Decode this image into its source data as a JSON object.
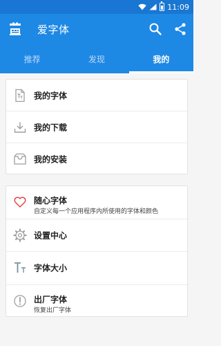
{
  "status_bar": {
    "time": "11:09"
  },
  "appbar": {
    "title": "爱字体",
    "icons": {
      "app": "app-logo-icon",
      "search": "search-icon",
      "share": "share-icon"
    }
  },
  "tabs": [
    {
      "label": "推荐",
      "active": false
    },
    {
      "label": "发现",
      "active": false
    },
    {
      "label": "我的",
      "active": true
    }
  ],
  "section1": {
    "items": [
      {
        "label": "我的字体",
        "icon": "font-file-icon"
      },
      {
        "label": "我的下载",
        "icon": "download-icon"
      },
      {
        "label": "我的安装",
        "icon": "inbox-icon"
      }
    ]
  },
  "section2": {
    "items": [
      {
        "label": "随心字体",
        "sub": "自定义每一个应用程序内所使用的字体和颜色",
        "icon": "heart-icon"
      },
      {
        "label": "设置中心",
        "icon": "gear-icon"
      },
      {
        "label": "字体大小",
        "icon": "font-size-icon"
      },
      {
        "label": "出厂字体",
        "sub": "恢复出厂字体",
        "icon": "restore-icon"
      }
    ]
  },
  "colors": {
    "primary": "#1e88e5",
    "status_bar": "#1976d2",
    "heart": "#e53935",
    "icon_gray": "#9e9e9e"
  }
}
